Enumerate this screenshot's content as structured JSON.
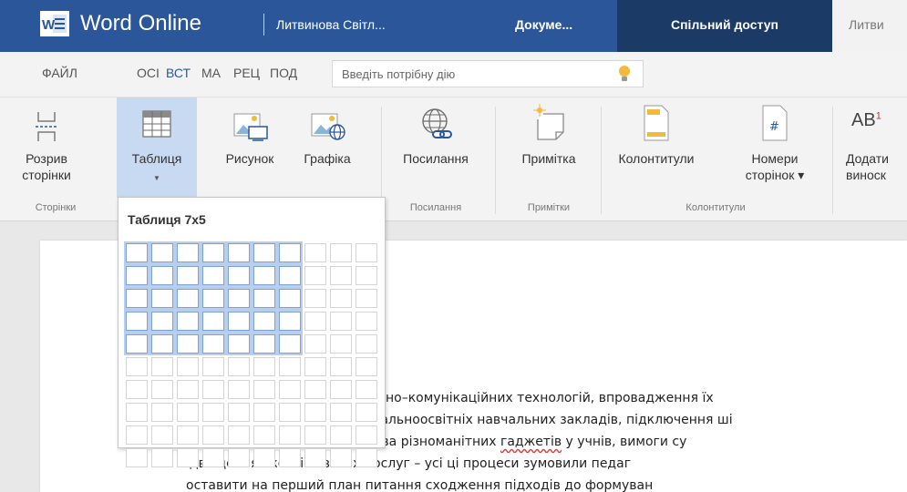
{
  "titlebar": {
    "app_title": "Word Online",
    "owner": "Литвинова Світл...",
    "document": "Докуме...",
    "share": "Спільний доступ",
    "user": "Литви"
  },
  "tabs": [
    {
      "label": "ФАЙЛ",
      "active": false
    },
    {
      "label": "ОСІ",
      "active": false
    },
    {
      "label": "ВСТ",
      "active": true
    },
    {
      "label": "МА",
      "active": false
    },
    {
      "label": "РЕЦ",
      "active": false
    },
    {
      "label": "ПОД",
      "active": false
    }
  ],
  "tell_me": {
    "placeholder": "Введіть потрібну дію"
  },
  "ribbon": {
    "buttons": {
      "page_break": {
        "line1": "Розрив",
        "line2": "сторінки"
      },
      "table": {
        "line1": "Таблиця",
        "line2": ""
      },
      "picture": {
        "line1": "Рисунок",
        "line2": ""
      },
      "graphics": {
        "line1": "Графіка",
        "line2": ""
      },
      "link": {
        "line1": "Посилання",
        "line2": ""
      },
      "comment": {
        "line1": "Примітка",
        "line2": ""
      },
      "header_footer": {
        "line1": "Колонтитули",
        "line2": ""
      },
      "page_numbers": {
        "line1": "Номери",
        "line2": "сторінок ▾"
      },
      "footnote": {
        "line1": "Додати",
        "line2": "виноск"
      }
    },
    "groups": {
      "pages": "Сторінки",
      "links": "Посилання",
      "comments": "Примітки",
      "header_footer": "Колонтитули"
    }
  },
  "table_picker": {
    "title": "Таблиця 7x5",
    "columns": 10,
    "rows": 10,
    "selected_columns": 7,
    "selected_rows": 5
  },
  "document": {
    "lines": [
      "ійно–комунікаційних технологій, впровадження їх",
      "гальноосвітніх навчальних закладів, підключення ші",
      {
        "pre": "ява різноманітних ",
        "err": "гаджетів",
        "post": " у учнів, вимоги су"
      },
      "ідвищення якості освітніх послуг – усі ці процеси зумовили педаг",
      "оставити на перший план питання сходження підходів до формуван"
    ]
  },
  "colors": {
    "titlebar": "#2b579a",
    "share": "#1b3a66",
    "selection": "#c8daf2",
    "grid_highlight": "#b9cdec"
  }
}
